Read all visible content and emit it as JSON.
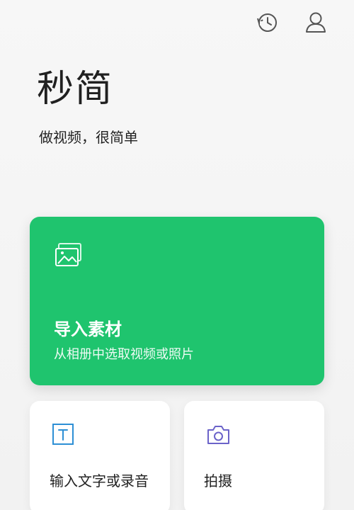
{
  "header": {
    "icons": [
      "history-icon",
      "profile-icon"
    ]
  },
  "brand": {
    "title": "秒简",
    "subtitle": "做视频，很简单"
  },
  "import_card": {
    "title": "导入素材",
    "subtitle": "从相册中选取视频或照片",
    "icon": "image-icon",
    "color": "#1fc46e"
  },
  "cards": {
    "text": {
      "label": "输入文字或录音",
      "icon": "text-icon",
      "icon_color": "#2d8fd5"
    },
    "shoot": {
      "label": "拍摄",
      "icon": "camera-icon",
      "icon_color": "#6b63c9"
    }
  }
}
